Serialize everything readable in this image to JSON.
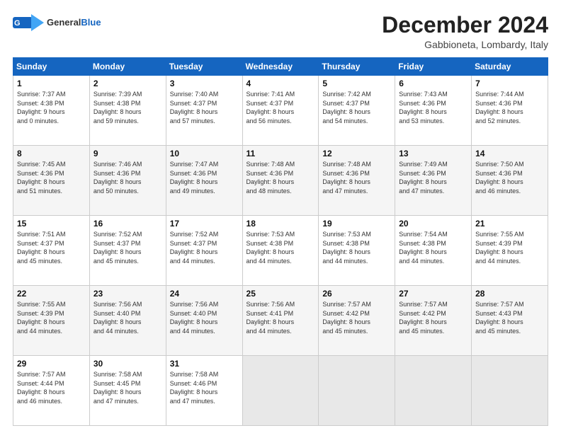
{
  "header": {
    "logo_general": "General",
    "logo_blue": "Blue",
    "month_title": "December 2024",
    "subtitle": "Gabbioneta, Lombardy, Italy"
  },
  "days_of_week": [
    "Sunday",
    "Monday",
    "Tuesday",
    "Wednesday",
    "Thursday",
    "Friday",
    "Saturday"
  ],
  "weeks": [
    [
      {
        "day": "1",
        "info": "Sunrise: 7:37 AM\nSunset: 4:38 PM\nDaylight: 9 hours\nand 0 minutes."
      },
      {
        "day": "2",
        "info": "Sunrise: 7:39 AM\nSunset: 4:38 PM\nDaylight: 8 hours\nand 59 minutes."
      },
      {
        "day": "3",
        "info": "Sunrise: 7:40 AM\nSunset: 4:37 PM\nDaylight: 8 hours\nand 57 minutes."
      },
      {
        "day": "4",
        "info": "Sunrise: 7:41 AM\nSunset: 4:37 PM\nDaylight: 8 hours\nand 56 minutes."
      },
      {
        "day": "5",
        "info": "Sunrise: 7:42 AM\nSunset: 4:37 PM\nDaylight: 8 hours\nand 54 minutes."
      },
      {
        "day": "6",
        "info": "Sunrise: 7:43 AM\nSunset: 4:36 PM\nDaylight: 8 hours\nand 53 minutes."
      },
      {
        "day": "7",
        "info": "Sunrise: 7:44 AM\nSunset: 4:36 PM\nDaylight: 8 hours\nand 52 minutes."
      }
    ],
    [
      {
        "day": "8",
        "info": "Sunrise: 7:45 AM\nSunset: 4:36 PM\nDaylight: 8 hours\nand 51 minutes."
      },
      {
        "day": "9",
        "info": "Sunrise: 7:46 AM\nSunset: 4:36 PM\nDaylight: 8 hours\nand 50 minutes."
      },
      {
        "day": "10",
        "info": "Sunrise: 7:47 AM\nSunset: 4:36 PM\nDaylight: 8 hours\nand 49 minutes."
      },
      {
        "day": "11",
        "info": "Sunrise: 7:48 AM\nSunset: 4:36 PM\nDaylight: 8 hours\nand 48 minutes."
      },
      {
        "day": "12",
        "info": "Sunrise: 7:48 AM\nSunset: 4:36 PM\nDaylight: 8 hours\nand 47 minutes."
      },
      {
        "day": "13",
        "info": "Sunrise: 7:49 AM\nSunset: 4:36 PM\nDaylight: 8 hours\nand 47 minutes."
      },
      {
        "day": "14",
        "info": "Sunrise: 7:50 AM\nSunset: 4:36 PM\nDaylight: 8 hours\nand 46 minutes."
      }
    ],
    [
      {
        "day": "15",
        "info": "Sunrise: 7:51 AM\nSunset: 4:37 PM\nDaylight: 8 hours\nand 45 minutes."
      },
      {
        "day": "16",
        "info": "Sunrise: 7:52 AM\nSunset: 4:37 PM\nDaylight: 8 hours\nand 45 minutes."
      },
      {
        "day": "17",
        "info": "Sunrise: 7:52 AM\nSunset: 4:37 PM\nDaylight: 8 hours\nand 44 minutes."
      },
      {
        "day": "18",
        "info": "Sunrise: 7:53 AM\nSunset: 4:38 PM\nDaylight: 8 hours\nand 44 minutes."
      },
      {
        "day": "19",
        "info": "Sunrise: 7:53 AM\nSunset: 4:38 PM\nDaylight: 8 hours\nand 44 minutes."
      },
      {
        "day": "20",
        "info": "Sunrise: 7:54 AM\nSunset: 4:38 PM\nDaylight: 8 hours\nand 44 minutes."
      },
      {
        "day": "21",
        "info": "Sunrise: 7:55 AM\nSunset: 4:39 PM\nDaylight: 8 hours\nand 44 minutes."
      }
    ],
    [
      {
        "day": "22",
        "info": "Sunrise: 7:55 AM\nSunset: 4:39 PM\nDaylight: 8 hours\nand 44 minutes."
      },
      {
        "day": "23",
        "info": "Sunrise: 7:56 AM\nSunset: 4:40 PM\nDaylight: 8 hours\nand 44 minutes."
      },
      {
        "day": "24",
        "info": "Sunrise: 7:56 AM\nSunset: 4:40 PM\nDaylight: 8 hours\nand 44 minutes."
      },
      {
        "day": "25",
        "info": "Sunrise: 7:56 AM\nSunset: 4:41 PM\nDaylight: 8 hours\nand 44 minutes."
      },
      {
        "day": "26",
        "info": "Sunrise: 7:57 AM\nSunset: 4:42 PM\nDaylight: 8 hours\nand 45 minutes."
      },
      {
        "day": "27",
        "info": "Sunrise: 7:57 AM\nSunset: 4:42 PM\nDaylight: 8 hours\nand 45 minutes."
      },
      {
        "day": "28",
        "info": "Sunrise: 7:57 AM\nSunset: 4:43 PM\nDaylight: 8 hours\nand 45 minutes."
      }
    ],
    [
      {
        "day": "29",
        "info": "Sunrise: 7:57 AM\nSunset: 4:44 PM\nDaylight: 8 hours\nand 46 minutes."
      },
      {
        "day": "30",
        "info": "Sunrise: 7:58 AM\nSunset: 4:45 PM\nDaylight: 8 hours\nand 47 minutes."
      },
      {
        "day": "31",
        "info": "Sunrise: 7:58 AM\nSunset: 4:46 PM\nDaylight: 8 hours\nand 47 minutes."
      },
      {
        "day": "",
        "info": ""
      },
      {
        "day": "",
        "info": ""
      },
      {
        "day": "",
        "info": ""
      },
      {
        "day": "",
        "info": ""
      }
    ]
  ]
}
